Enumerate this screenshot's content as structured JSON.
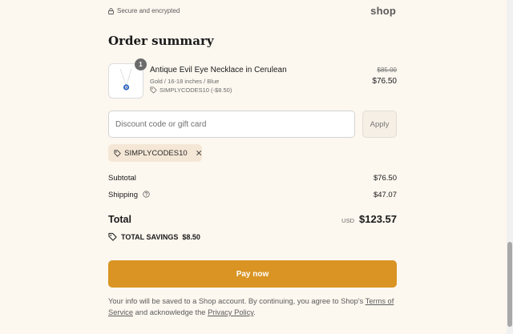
{
  "header": {
    "secure_text": "Secure and encrypted",
    "shop_logo": "shop"
  },
  "summary": {
    "title": "Order summary"
  },
  "item": {
    "quantity": "1",
    "name": "Antique Evil Eye Necklace in Cerulean",
    "variant": "Gold / 16-18 inches / Blue",
    "discount": "SIMPLYCODES10 (-$8.50)",
    "price_original": "$85.00",
    "price_discounted": "$76.50",
    "thumbnail_icon": "necklace-icon"
  },
  "discount": {
    "placeholder": "Discount code or gift card",
    "value": "",
    "apply_label": "Apply",
    "applied_code": "SIMPLYCODES10"
  },
  "totals": {
    "subtotal_label": "Subtotal",
    "subtotal_value": "$76.50",
    "shipping_label": "Shipping",
    "shipping_value": "$47.07",
    "total_label": "Total",
    "currency": "USD",
    "total_value": "$123.57",
    "savings_label": "TOTAL SAVINGS",
    "savings_value": "$8.50"
  },
  "pay": {
    "label": "Pay now"
  },
  "disclaimer": {
    "text_1": "Your info will be saved to a Shop account. By continuing, you agree to Shop's ",
    "terms_link": "Terms of Service",
    "text_2": " and acknowledge the ",
    "privacy_link": "Privacy Policy",
    "text_3": "."
  },
  "colors": {
    "background": "#fcf7ef",
    "accent": "#d99423",
    "chip": "#f5e7d6"
  }
}
